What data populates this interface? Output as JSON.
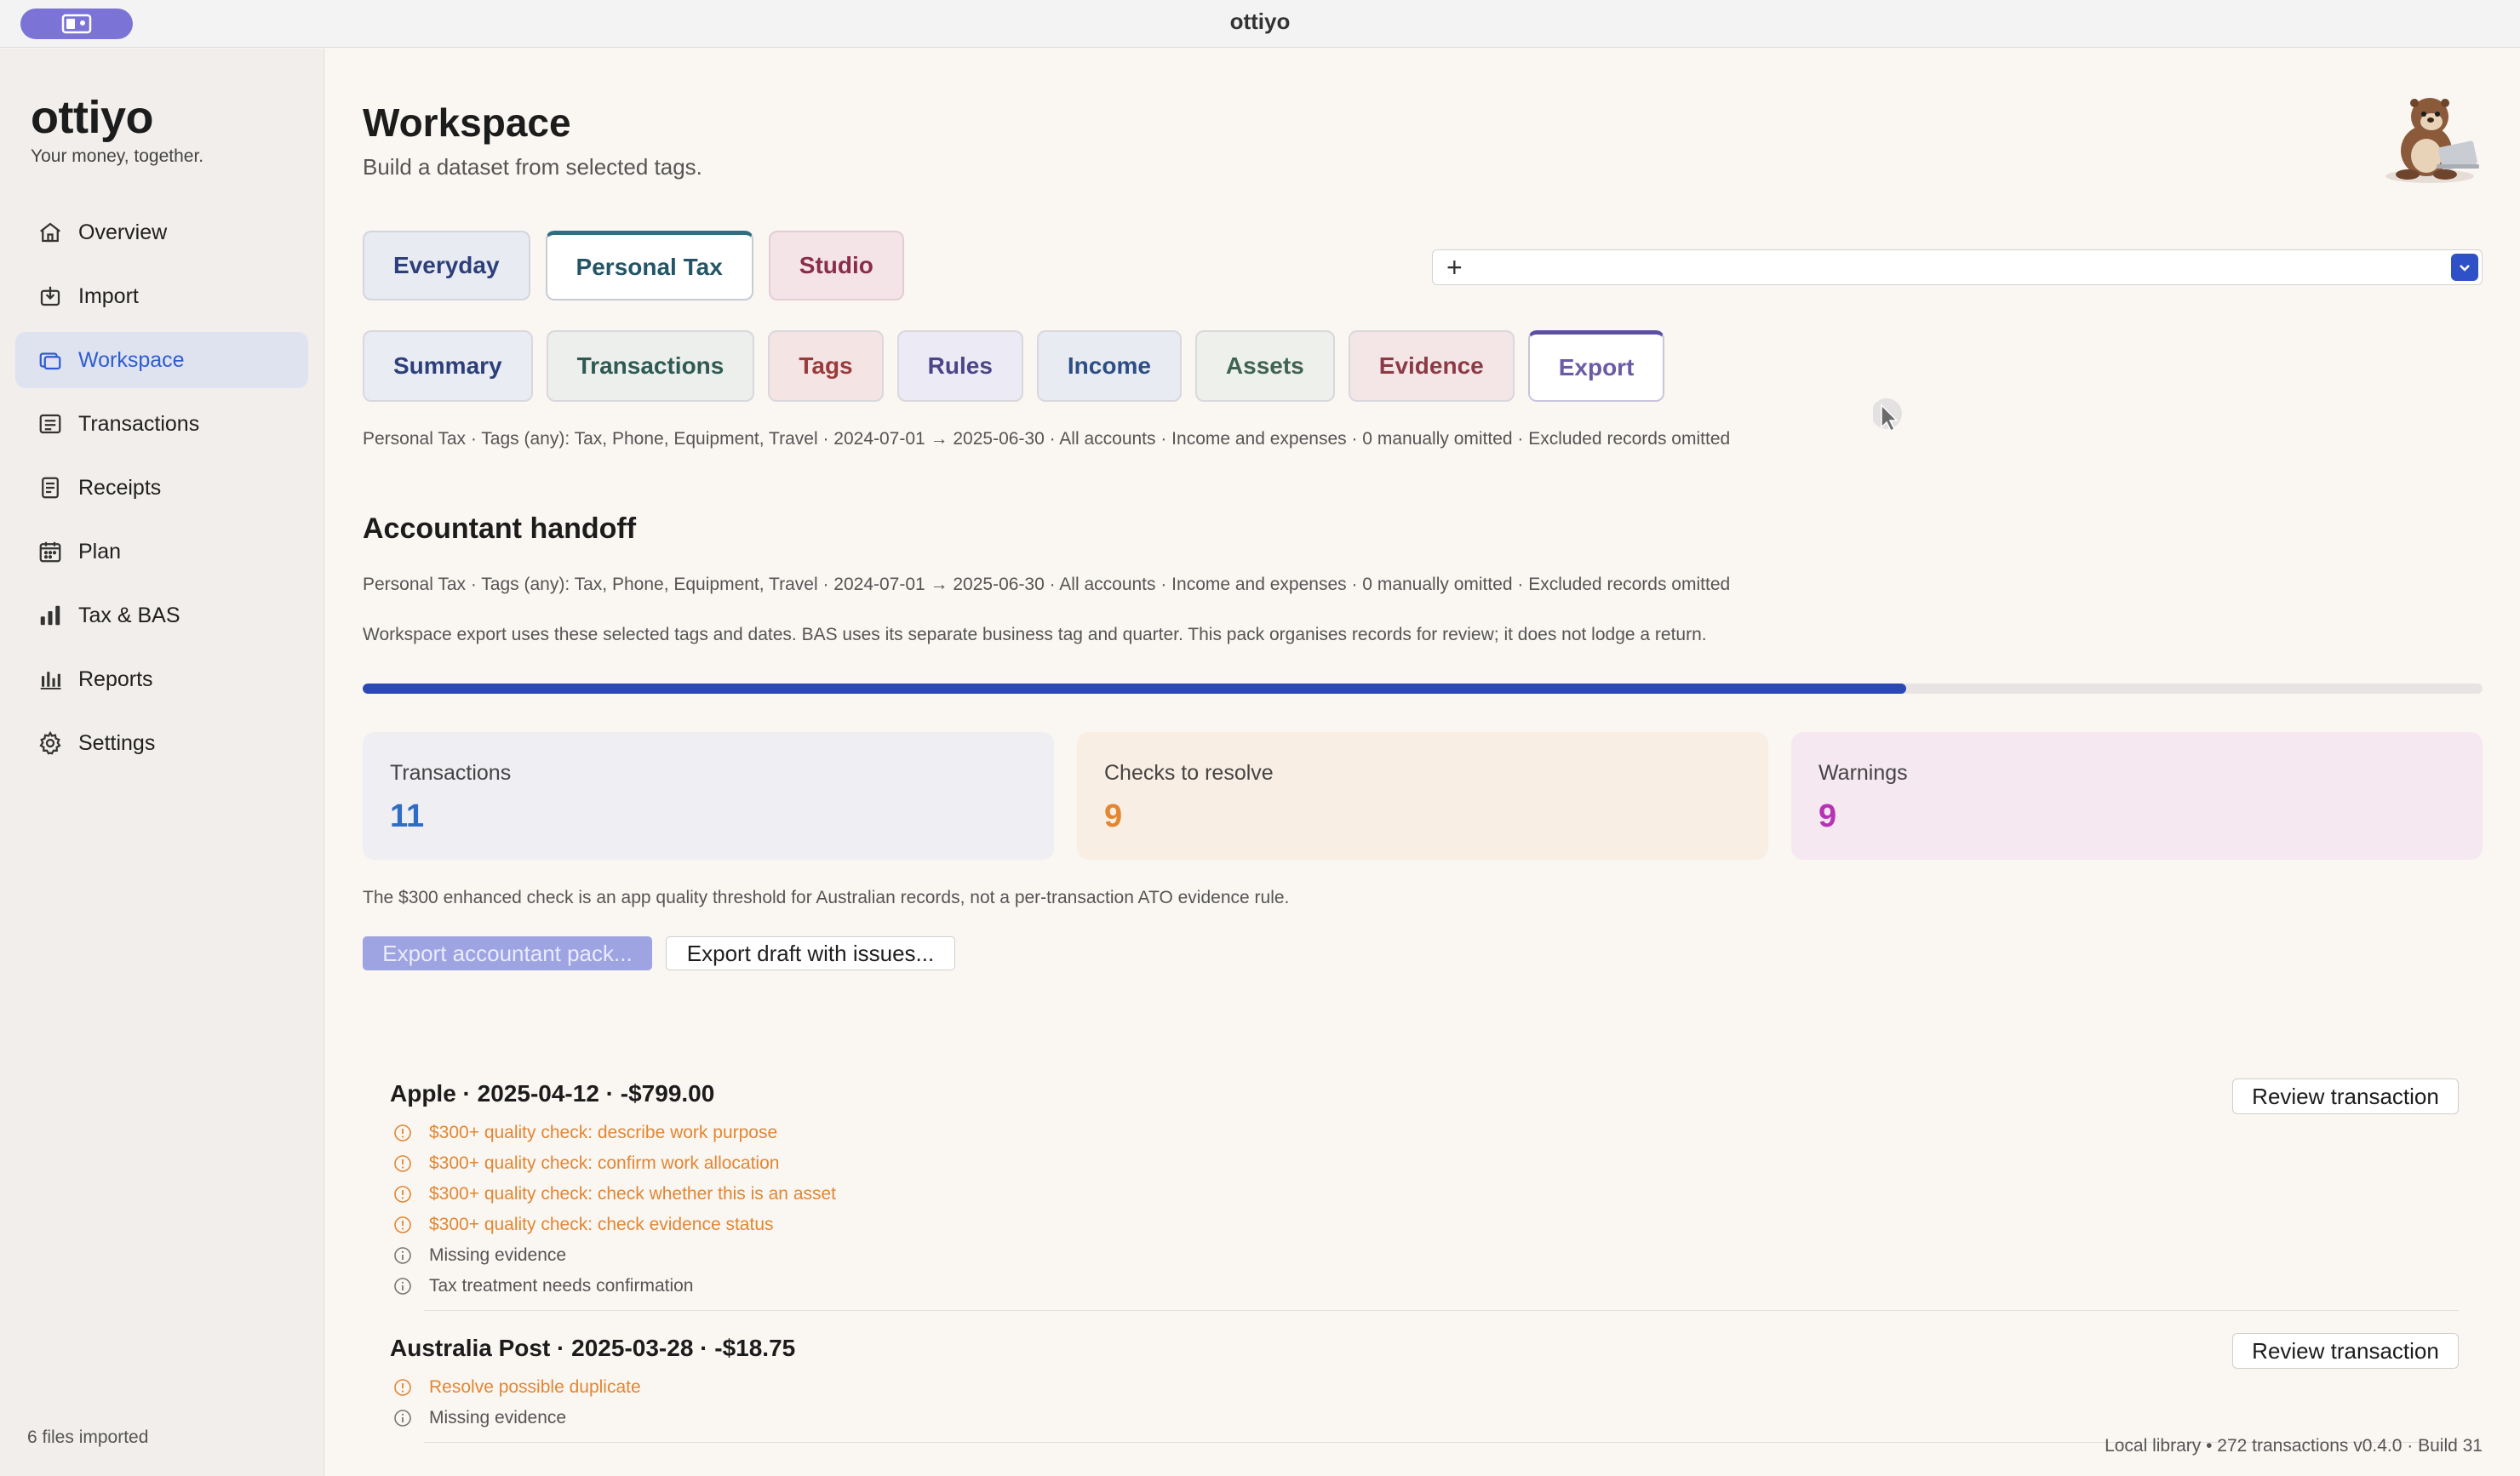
{
  "window": {
    "title": "ottiyo"
  },
  "sidebar": {
    "brand": "ottiyo",
    "tagline": "Your money, together.",
    "items": [
      {
        "label": "Overview",
        "icon": "home-icon"
      },
      {
        "label": "Import",
        "icon": "import-icon"
      },
      {
        "label": "Workspace",
        "icon": "workspace-icon",
        "active": true
      },
      {
        "label": "Transactions",
        "icon": "transactions-icon"
      },
      {
        "label": "Receipts",
        "icon": "receipt-icon"
      },
      {
        "label": "Plan",
        "icon": "calendar-icon"
      },
      {
        "label": "Tax & BAS",
        "icon": "bar-chart-icon"
      },
      {
        "label": "Reports",
        "icon": "reports-icon"
      },
      {
        "label": "Settings",
        "icon": "gear-icon"
      }
    ],
    "files_imported": "6 files imported"
  },
  "header": {
    "title": "Workspace",
    "subtitle": "Build a dataset from selected tags."
  },
  "workspace_tabs": [
    "Everyday",
    "Personal Tax",
    "Studio"
  ],
  "tag_combo": {
    "plus": "+"
  },
  "sub_tabs": [
    "Summary",
    "Transactions",
    "Tags",
    "Rules",
    "Income",
    "Assets",
    "Evidence",
    "Export"
  ],
  "scope_line": "Personal Tax · Tags (any): Tax, Phone, Equipment, Travel · 2024-07-01 → 2025-06-30 · All accounts · Income and expenses · 0 manually omitted · Excluded records omitted",
  "handoff": {
    "title": "Accountant handoff",
    "scope_line": "Personal Tax · Tags (any): Tax, Phone, Equipment, Travel · 2024-07-01 → 2025-06-30 · All accounts · Income and expenses · 0 manually omitted · Excluded records omitted",
    "explain": "Workspace export uses these selected tags and dates. BAS uses its separate business tag and quarter. This pack organises records for review; it does not lodge a return.",
    "progress": 0.728
  },
  "stats": {
    "transactions": {
      "label": "Transactions",
      "value": "11"
    },
    "checks": {
      "label": "Checks to resolve",
      "value": "9"
    },
    "warnings": {
      "label": "Warnings",
      "value": "9"
    }
  },
  "threshold_note": "The $300 enhanced check is an app quality threshold for Australian records, not a per-transaction ATO evidence rule.",
  "actions": {
    "export_pack": "Export accountant pack...",
    "export_draft": "Export draft with issues..."
  },
  "issues": [
    {
      "title": "Apple · 2025-04-12 · -$799.00",
      "review": "Review transaction",
      "lines": [
        {
          "text": "$300+ quality check: describe work purpose",
          "level": "warn"
        },
        {
          "text": "$300+ quality check: confirm work allocation",
          "level": "warn"
        },
        {
          "text": "$300+ quality check: check whether this is an asset",
          "level": "warn"
        },
        {
          "text": "$300+ quality check: check evidence status",
          "level": "warn"
        },
        {
          "text": "Missing evidence",
          "level": "info"
        },
        {
          "text": "Tax treatment needs confirmation",
          "level": "info"
        }
      ]
    },
    {
      "title": "Australia Post · 2025-03-28 · -$18.75",
      "review": "Review transaction",
      "lines": [
        {
          "text": "Resolve possible duplicate",
          "level": "warn"
        },
        {
          "text": "Missing evidence",
          "level": "info"
        }
      ]
    }
  ],
  "footer": {
    "status": "Local library • 272 transactions   v0.4.0 · Build 31"
  },
  "colors": {
    "accent": "#2f5ccf",
    "progress": "#2c48b5",
    "warn": "#e38631",
    "warnings_value": "#b733b5"
  }
}
